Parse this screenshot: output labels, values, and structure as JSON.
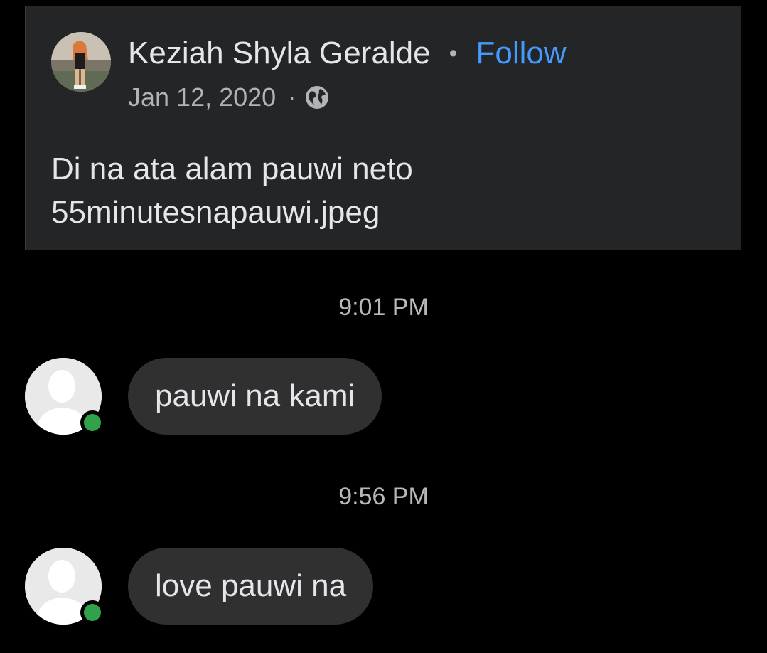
{
  "post": {
    "author_name": "Keziah Shyla Geralde",
    "separator": "•",
    "follow_label": "Follow",
    "date": "Jan 12, 2020",
    "meta_separator": "·",
    "privacy_icon": "globe-icon",
    "text_line1": "Di na ata alam pauwi neto",
    "text_line2": "55minutesnapauwi.jpeg"
  },
  "chat": {
    "messages": [
      {
        "time": "9:01 PM",
        "text": "pauwi na kami"
      },
      {
        "time": "9:56 PM",
        "text": "love pauwi na"
      }
    ]
  },
  "colors": {
    "card_bg": "#242526",
    "chat_bg": "#000000",
    "link": "#4599ff",
    "online": "#31a24c",
    "bubble": "#303030"
  }
}
